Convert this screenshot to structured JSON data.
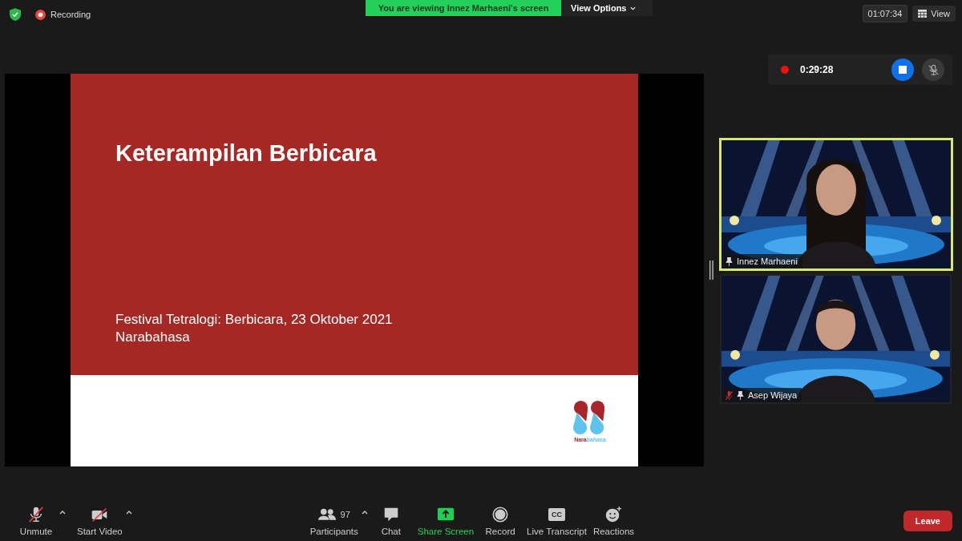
{
  "top_bar": {
    "recording_label": "Recording",
    "banner": "You are viewing Innez Marhaeni's screen",
    "view_options": "View Options",
    "meeting_time": "01:07:34",
    "view_button": "View"
  },
  "slide": {
    "title": "Keterampilan Berbicara",
    "subtitle_lines": [
      "Festival Tetralogi: Berbicara, 23 Oktober 2021",
      "Narabahasa"
    ],
    "logo_text_parts": [
      "Nara",
      "bahasa"
    ]
  },
  "recording_panel": {
    "elapsed": "0:29:28"
  },
  "participants": [
    {
      "name": "Innez Marhaeni",
      "speaking": true,
      "muted": false
    },
    {
      "name": "Asep Wijaya",
      "speaking": false,
      "muted": true
    }
  ],
  "left_controls": [
    {
      "kind": "mic",
      "label": "Unmute",
      "off": true,
      "menu": true
    },
    {
      "kind": "video",
      "label": "Start Video",
      "off": true,
      "menu": true
    }
  ],
  "center_controls": [
    {
      "kind": "participants",
      "label": "Participants",
      "count": "97",
      "menu": true
    },
    {
      "kind": "chat",
      "label": "Chat"
    },
    {
      "kind": "share",
      "label": "Share Screen"
    },
    {
      "kind": "record",
      "label": "Record"
    },
    {
      "kind": "cc",
      "label": "Live Transcript",
      "icon_text": "CC"
    },
    {
      "kind": "reactions",
      "label": "Reactions"
    }
  ],
  "leave_button": "Leave"
}
